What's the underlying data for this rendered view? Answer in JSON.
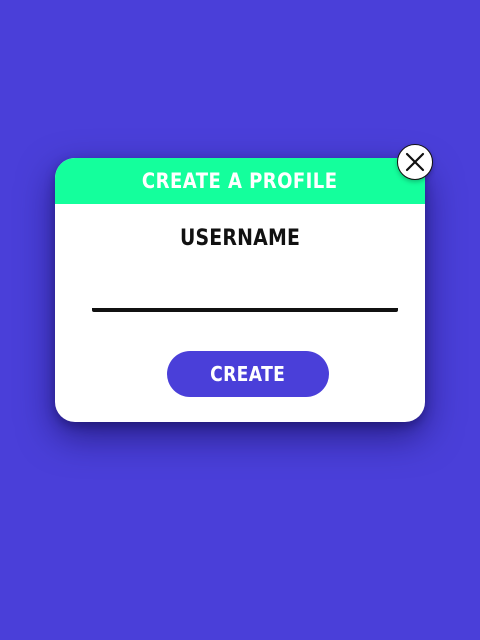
{
  "modal": {
    "title": "CREATE A PROFILE",
    "close_icon": "close-icon",
    "username_label": "USERNAME",
    "username_value": "",
    "username_placeholder": "",
    "create_label": "CREATE"
  },
  "colors": {
    "background": "#4a3fd9",
    "header": "#14ff9c",
    "button": "#4a3fd9"
  }
}
